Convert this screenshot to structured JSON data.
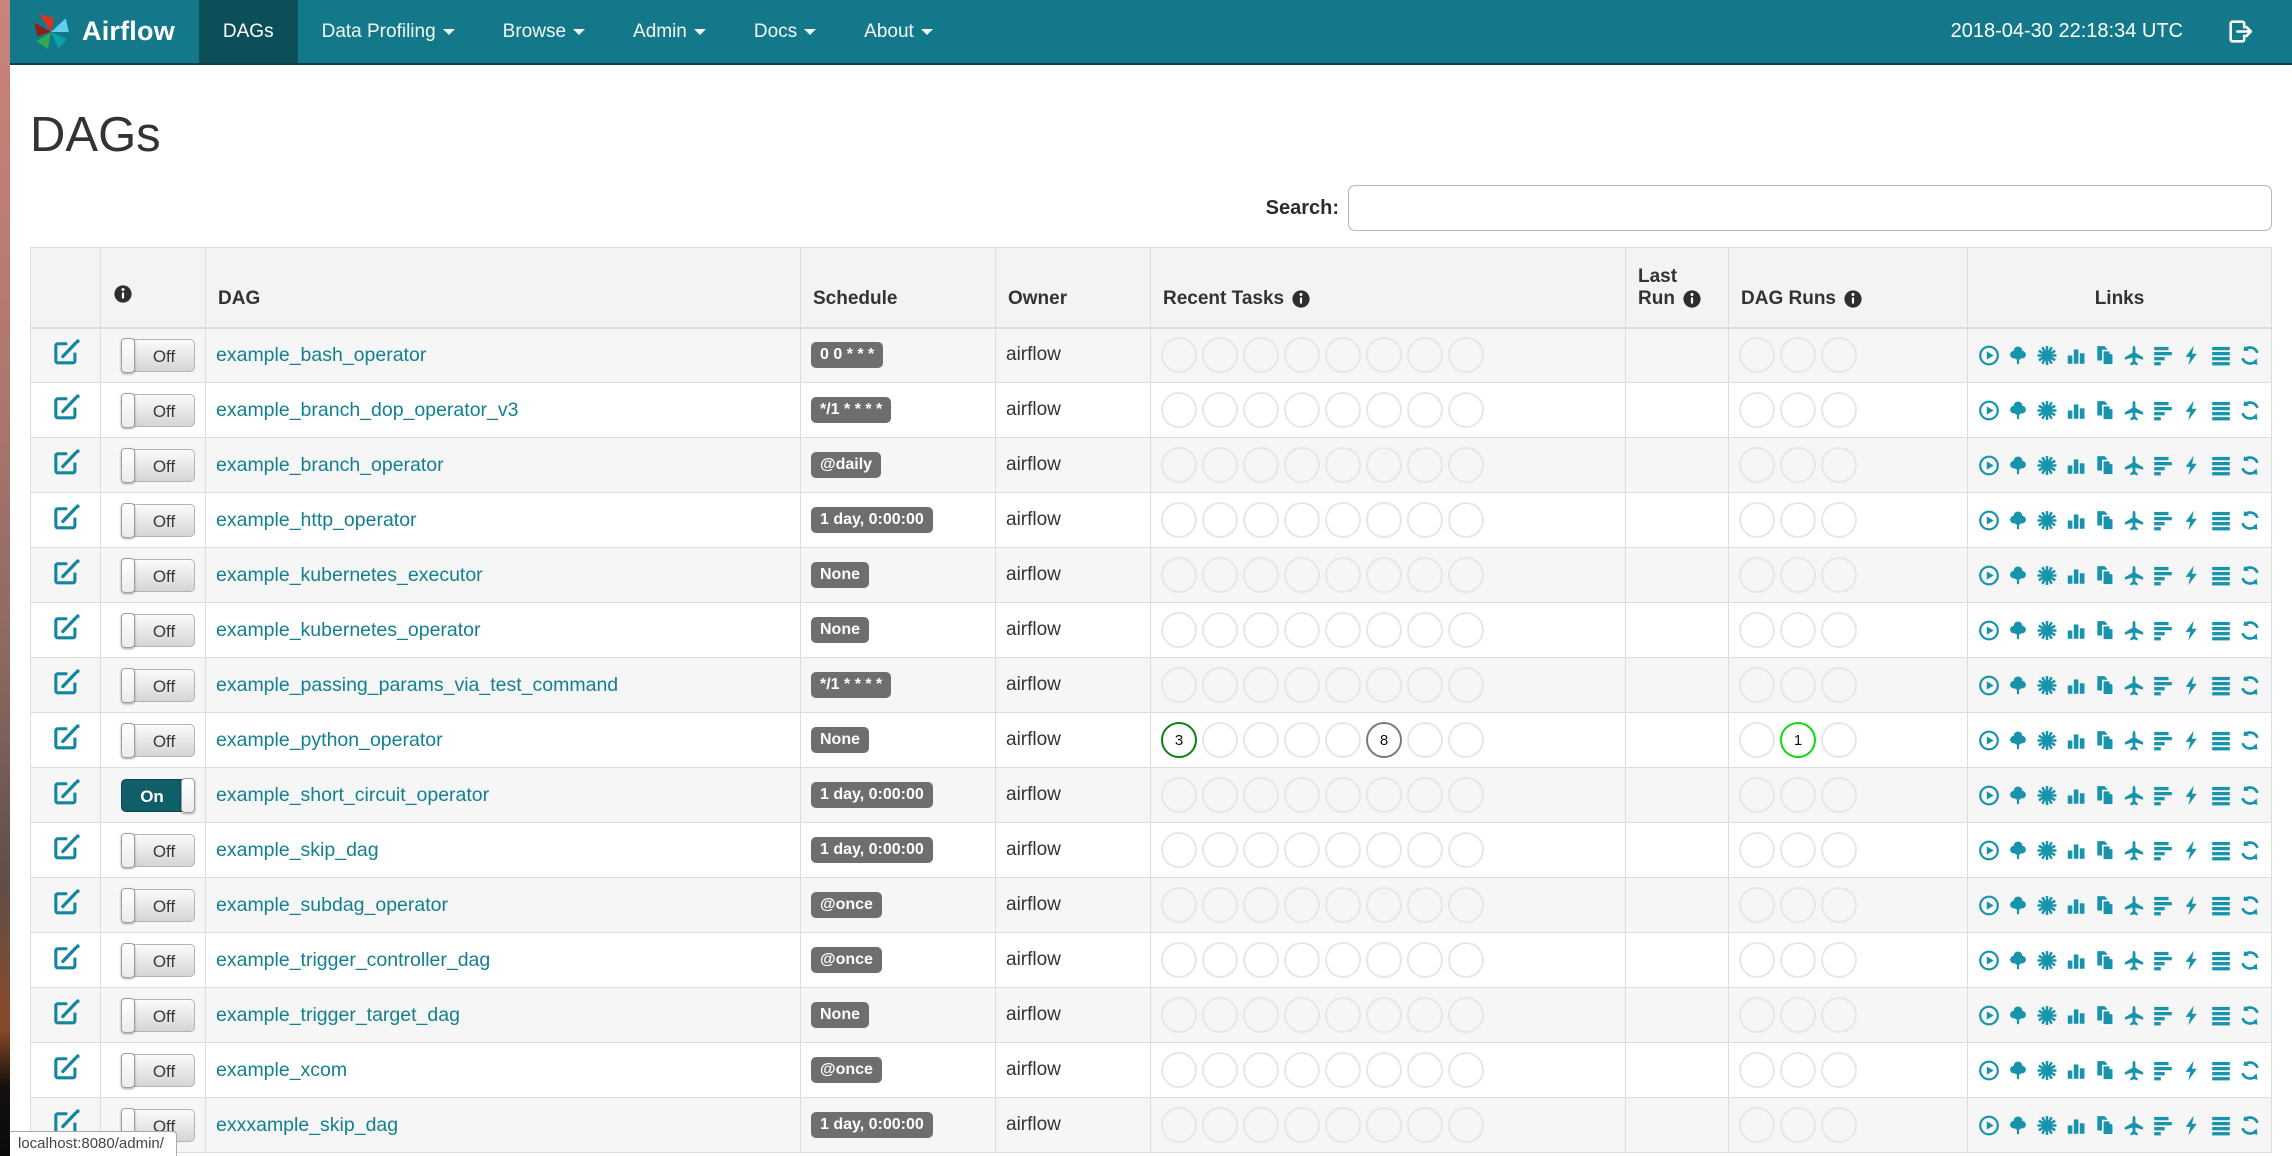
{
  "theme": {
    "navbar_bg": "#13788a",
    "navbar_active_bg": "#0d4f59",
    "link_color": "#12808f",
    "icon_color": "#1793ab",
    "schedule_badge_bg": "#6e6e6e",
    "toggle_on_bg": "#0f5e68",
    "state_success_color": "#0e8011",
    "state_running_color": "#08dc0c",
    "state_queued_color": "#7a7a7a"
  },
  "navbar": {
    "brand": "Airflow",
    "clock": "2018-04-30 22:18:34 UTC",
    "items": [
      {
        "label": "DAGs",
        "active": true,
        "caret": false
      },
      {
        "label": "Data Profiling",
        "active": false,
        "caret": true
      },
      {
        "label": "Browse",
        "active": false,
        "caret": true
      },
      {
        "label": "Admin",
        "active": false,
        "caret": true
      },
      {
        "label": "Docs",
        "active": false,
        "caret": true
      },
      {
        "label": "About",
        "active": false,
        "caret": true
      }
    ]
  },
  "page": {
    "title": "DAGs",
    "search_label": "Search:",
    "search_value": "",
    "status_bar": "localhost:8080/admin/"
  },
  "table": {
    "headers": {
      "dag": "DAG",
      "schedule": "Schedule",
      "owner": "Owner",
      "recent_tasks": "Recent Tasks",
      "last_run_line1": "Last",
      "last_run_line2": "Run",
      "dag_runs": "DAG Runs",
      "links": "Links"
    },
    "recent_task_slots": 8,
    "dag_run_slots": 3,
    "link_icons": [
      {
        "name": "trigger-dag",
        "icon": "play-circle"
      },
      {
        "name": "tree-view",
        "icon": "tree"
      },
      {
        "name": "graph-view",
        "icon": "sunburst"
      },
      {
        "name": "task-duration",
        "icon": "bar-chart"
      },
      {
        "name": "task-tries",
        "icon": "duplicate"
      },
      {
        "name": "landing-times",
        "icon": "plane"
      },
      {
        "name": "gantt-view",
        "icon": "gantt"
      },
      {
        "name": "code-view",
        "icon": "flash"
      },
      {
        "name": "logs",
        "icon": "justify"
      },
      {
        "name": "refresh",
        "icon": "refresh"
      }
    ],
    "rows": [
      {
        "name": "example_bash_operator",
        "schedule": "0 0 * * *",
        "owner": "airflow",
        "is_on": false,
        "toggle_label": "Off",
        "recent_tasks": [],
        "last_run": "",
        "dag_runs": []
      },
      {
        "name": "example_branch_dop_operator_v3",
        "schedule": "*/1 * * * *",
        "owner": "airflow",
        "is_on": false,
        "toggle_label": "Off",
        "recent_tasks": [],
        "last_run": "",
        "dag_runs": []
      },
      {
        "name": "example_branch_operator",
        "schedule": "@daily",
        "owner": "airflow",
        "is_on": false,
        "toggle_label": "Off",
        "recent_tasks": [],
        "last_run": "",
        "dag_runs": []
      },
      {
        "name": "example_http_operator",
        "schedule": "1 day, 0:00:00",
        "owner": "airflow",
        "is_on": false,
        "toggle_label": "Off",
        "recent_tasks": [],
        "last_run": "",
        "dag_runs": []
      },
      {
        "name": "example_kubernetes_executor",
        "schedule": "None",
        "owner": "airflow",
        "is_on": false,
        "toggle_label": "Off",
        "recent_tasks": [],
        "last_run": "",
        "dag_runs": []
      },
      {
        "name": "example_kubernetes_operator",
        "schedule": "None",
        "owner": "airflow",
        "is_on": false,
        "toggle_label": "Off",
        "recent_tasks": [],
        "last_run": "",
        "dag_runs": []
      },
      {
        "name": "example_passing_params_via_test_command",
        "schedule": "*/1 * * * *",
        "owner": "airflow",
        "is_on": false,
        "toggle_label": "Off",
        "recent_tasks": [],
        "last_run": "",
        "dag_runs": []
      },
      {
        "name": "example_python_operator",
        "schedule": "None",
        "owner": "airflow",
        "is_on": false,
        "toggle_label": "Off",
        "recent_tasks": [
          {
            "slot": 0,
            "value": "3",
            "state": "success"
          },
          {
            "slot": 5,
            "value": "8",
            "state": "queued"
          }
        ],
        "last_run": "",
        "dag_runs": [
          {
            "slot": 1,
            "value": "1",
            "state": "running"
          }
        ]
      },
      {
        "name": "example_short_circuit_operator",
        "schedule": "1 day, 0:00:00",
        "owner": "airflow",
        "is_on": true,
        "toggle_label": "On",
        "recent_tasks": [],
        "last_run": "",
        "dag_runs": []
      },
      {
        "name": "example_skip_dag",
        "schedule": "1 day, 0:00:00",
        "owner": "airflow",
        "is_on": false,
        "toggle_label": "Off",
        "recent_tasks": [],
        "last_run": "",
        "dag_runs": []
      },
      {
        "name": "example_subdag_operator",
        "schedule": "@once",
        "owner": "airflow",
        "is_on": false,
        "toggle_label": "Off",
        "recent_tasks": [],
        "last_run": "",
        "dag_runs": []
      },
      {
        "name": "example_trigger_controller_dag",
        "schedule": "@once",
        "owner": "airflow",
        "is_on": false,
        "toggle_label": "Off",
        "recent_tasks": [],
        "last_run": "",
        "dag_runs": []
      },
      {
        "name": "example_trigger_target_dag",
        "schedule": "None",
        "owner": "airflow",
        "is_on": false,
        "toggle_label": "Off",
        "recent_tasks": [],
        "last_run": "",
        "dag_runs": []
      },
      {
        "name": "example_xcom",
        "schedule": "@once",
        "owner": "airflow",
        "is_on": false,
        "toggle_label": "Off",
        "recent_tasks": [],
        "last_run": "",
        "dag_runs": []
      },
      {
        "name": "exxxample_skip_dag",
        "schedule": "1 day, 0:00:00",
        "owner": "airflow",
        "is_on": false,
        "toggle_label": "Off",
        "recent_tasks": [],
        "last_run": "",
        "dag_runs": []
      }
    ]
  }
}
